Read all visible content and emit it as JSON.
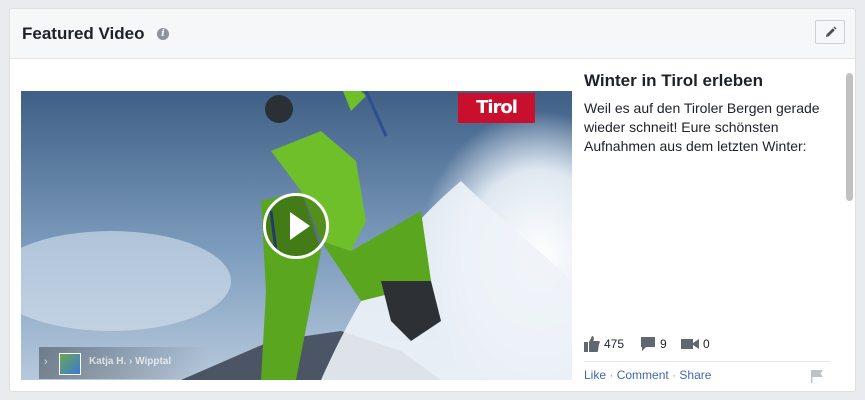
{
  "header": {
    "title": "Featured Video",
    "info_icon": "info-icon",
    "edit_icon": "pencil-icon"
  },
  "video": {
    "brand_logo": "Tirol",
    "play_icon": "play-icon",
    "credit": {
      "author": "Katja H.",
      "location": "Wipptal"
    }
  },
  "post": {
    "title": "Winter in Tirol erleben",
    "text": "Weil es auf den Tiroler Bergen gerade wieder schneit! Eure schönsten Aufnahmen aus dem letzten Winter:",
    "stats": {
      "likes": "475",
      "comments": "9",
      "shares": "0"
    },
    "actions": {
      "like": "Like",
      "comment": "Comment",
      "share": "Share",
      "separator": "·"
    }
  },
  "colors": {
    "link": "#4267b2",
    "brand_red": "#c8102e",
    "header_bg": "#f6f7f9"
  }
}
